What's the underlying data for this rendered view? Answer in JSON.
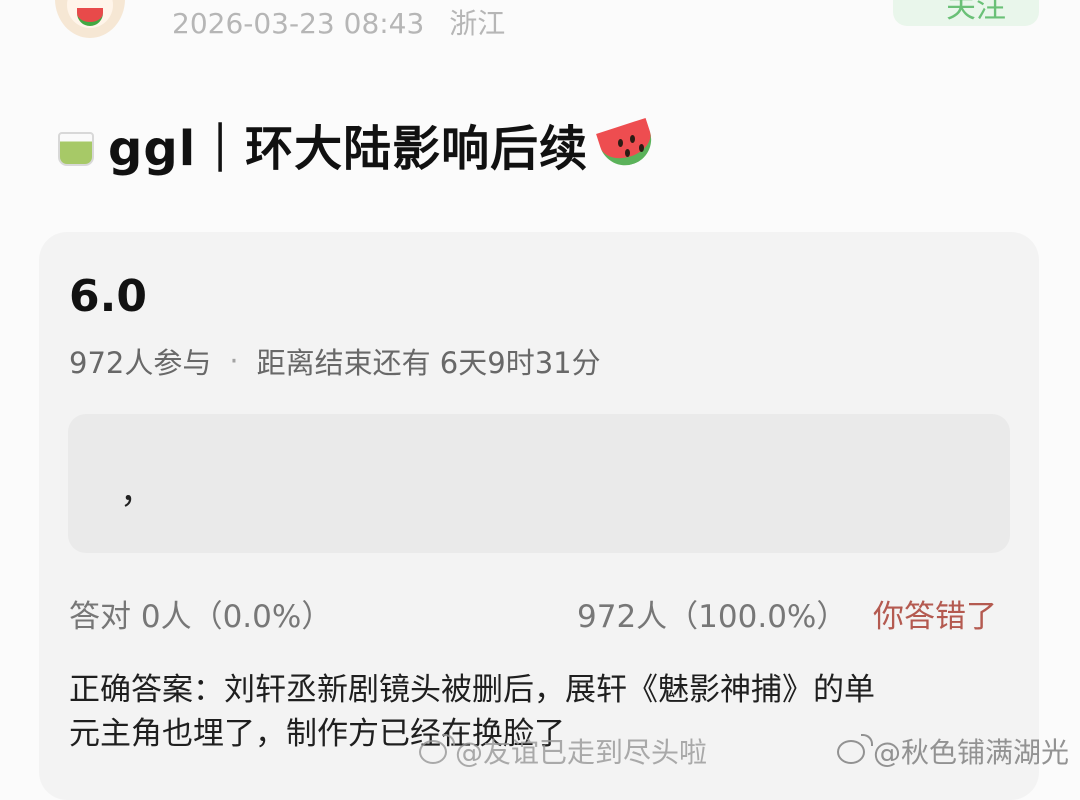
{
  "post": {
    "datetime": "2026-03-23 08:43",
    "location": "浙江",
    "follow_label": "关注",
    "title": "ggl｜环大陆影响后续"
  },
  "quiz": {
    "score": "6.0",
    "participants": "972人参与",
    "separator": "·",
    "time_left": "距离结束还有 6天9时31分",
    "option_text": "，",
    "correct_stat": "答对  0人（0.0%）",
    "wrong_stat": "972人（100.0%）",
    "wrong_badge": "你答错了",
    "answer": "正确答案：刘轩丞新剧镜头被删后，展轩《魅影神捕》的单\n元主角也埋了，制作方已经在换脸了"
  },
  "watermarks": {
    "center": "@友谊已走到尽头啦",
    "right": "@秋色铺满湖光"
  },
  "icons": {
    "avatar": "watermelon-avatar",
    "leading": "tea-icon",
    "trailing": "watermelon-icon",
    "weibo": "weibo-icon"
  },
  "colors": {
    "follow": "#6ac077",
    "wrong": "#b45a50",
    "card": "#f3f3f3"
  }
}
